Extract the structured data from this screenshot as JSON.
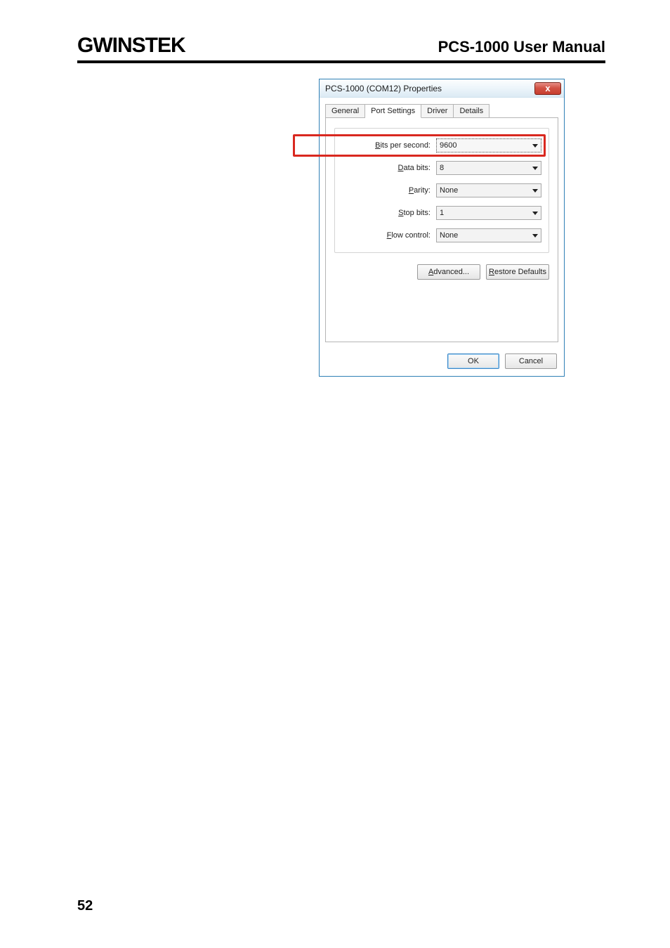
{
  "header": {
    "brand_text": "GWINSTEK",
    "right_title": "PCS-1000 User Manual"
  },
  "dialog": {
    "title": "PCS-1000 (COM12) Properties",
    "close_glyph": "x",
    "tabs": [
      {
        "label": "General"
      },
      {
        "label": "Port Settings"
      },
      {
        "label": "Driver"
      },
      {
        "label": "Details"
      }
    ],
    "active_tab_index": 1,
    "fields": {
      "bits_per_second": {
        "label_pre": "B",
        "label_rest": "its per second:",
        "value": "9600"
      },
      "data_bits": {
        "label_pre": "D",
        "label_rest": "ata bits:",
        "value": "8"
      },
      "parity": {
        "label_pre": "P",
        "label_rest": "arity:",
        "value": "None"
      },
      "stop_bits": {
        "label_pre": "S",
        "label_rest": "top bits:",
        "value": "1"
      },
      "flow_control": {
        "label_pre": "F",
        "label_rest": "low control:",
        "value": "None"
      }
    },
    "buttons": {
      "advanced": {
        "pre": "A",
        "rest": "dvanced..."
      },
      "restore_defaults": {
        "pre": "R",
        "rest": "estore Defaults"
      },
      "ok": "OK",
      "cancel": "Cancel"
    }
  },
  "page_number": "52"
}
